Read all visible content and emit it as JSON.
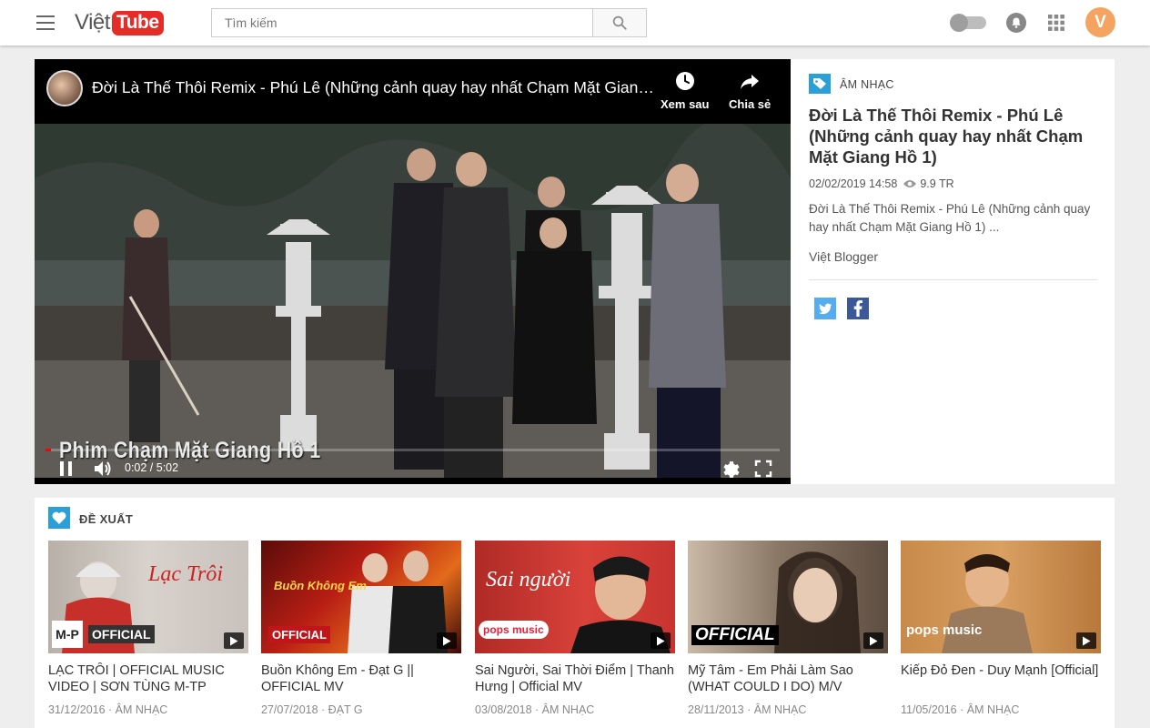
{
  "header": {
    "logo_text": "Việt",
    "logo_badge": "Tube",
    "search_placeholder": "Tìm kiếm",
    "avatar_letter": "V"
  },
  "player": {
    "title": "Đời Là Thế Thôi Remix - Phú Lê (Những cảnh quay hay nhất Chạm Mặt Giang Hồ 1)",
    "watch_later": "Xem sau",
    "share": "Chia sẻ",
    "caption": "Phim Chạm Mặt Giang Hồ 1",
    "current_time": "0:02 / 5:02",
    "progress": 0.007
  },
  "info": {
    "category": "ÂM NHẠC",
    "title": "Đời Là Thế Thôi Remix - Phú Lê (Những cảnh quay hay nhất Chạm Mặt Giang Hồ 1)",
    "date": "02/02/2019 14:58",
    "views": "9.9 TR",
    "description": "Đời Là Thế Thôi Remix - Phú Lê (Những cảnh quay hay nhất Chạm Mặt Giang Hồ 1) ...",
    "author": "Việt Blogger"
  },
  "recommendations": {
    "heading": "ĐỀ XUẤT",
    "items": [
      {
        "title": "LẠC TRÔI | OFFICIAL MUSIC VIDEO | SƠN TÙNG M-TP",
        "meta": "31/12/2016 · ÂM NHẠC",
        "badge": "OFFICIAL",
        "thumb_text": "Lạc Trôi"
      },
      {
        "title": "Buồn Không Em - Đạt G || OFFICIAL MV",
        "meta": "27/07/2018 · ĐẠT G",
        "badge": "OFFICIAL",
        "thumb_text": "Buồn Không Em"
      },
      {
        "title": "Sai Người, Sai Thời Điểm | Thanh Hưng | Official MV",
        "meta": "03/08/2018 · ÂM NHẠC",
        "badge": "pops music",
        "thumb_text": "Sai người"
      },
      {
        "title": "Mỹ Tâm - Em Phải Làm Sao (WHAT COULD I DO) M/V",
        "meta": "28/11/2013 · ÂM NHẠC",
        "badge": "OFFICIAL",
        "thumb_text": ""
      },
      {
        "title": "Kiếp Đỏ Đen - Duy Mạnh [Official]",
        "meta": "11/05/2016 · ÂM NHẠC",
        "badge": "pops music",
        "thumb_text": ""
      }
    ]
  },
  "colors": {
    "brand_red": "#e52d27",
    "accent_blue": "#2a9fd8",
    "twitter": "#55acee",
    "facebook": "#3b5998",
    "progress_red": "#ff0000"
  }
}
